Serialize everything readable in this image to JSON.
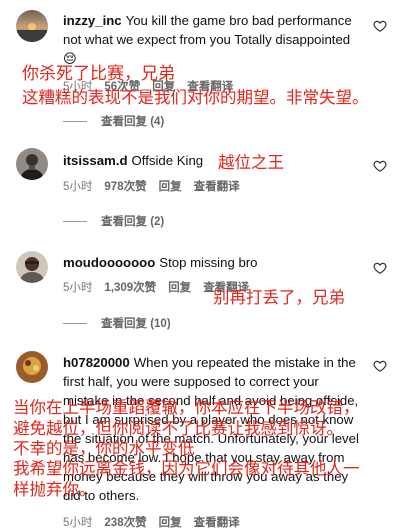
{
  "comments": [
    {
      "username": "inzzy_inc",
      "text": "You kill the game bro bad performance not what we expect from you Totally disappointed",
      "emoji": "😔",
      "time": "5小时",
      "likes": "56次赞",
      "reply_label": "回复",
      "translate_label": "查看翻译",
      "view_replies": "查看回复 (4)"
    },
    {
      "username": "itsissam.d",
      "text": "Offside King",
      "time": "5小时",
      "likes": "978次赞",
      "reply_label": "回复",
      "translate_label": "查看翻译",
      "view_replies": "查看回复 (2)"
    },
    {
      "username": "moudooooooo",
      "text": "Stop missing bro",
      "time": "5小时",
      "likes": "1,309次赞",
      "reply_label": "回复",
      "translate_label": "查看翻译",
      "view_replies": "查看回复 (10)"
    },
    {
      "username": "h07820000",
      "text": "When you repeated the mistake in the first half, you were supposed to correct your mistake in the second half and avoid being offside, but I am surprised by a player who does not know the situation of the match. Unfortunately, your level has become low. I hope that you stay away from money because they will throw you away as they did to others.",
      "time": "5小时",
      "likes": "238次赞",
      "reply_label": "回复",
      "translate_label": "查看翻译"
    }
  ],
  "translations": {
    "c1_line1": "你杀死了比赛，兄弟",
    "c1_line2": "这糟糕的表现不是我们对你的期望。非常失望。",
    "c2": "越位之王",
    "c3": "别再打丢了，兄弟",
    "c4_line1": "当你在上半场重蹈覆辙，你本应在下半场改错，",
    "c4_line2": "避免越位，但你阅读不了比赛让我感到惊讶。",
    "c4_line3": "不幸的是，你的水平变低",
    "c4_line4": "我希望你远离金钱，因为它们会像对待其他人一",
    "c4_line5": "样抛弃你。"
  },
  "colors": {
    "overlay_red": "#e3261b",
    "meta_gray": "#777777"
  },
  "icons": {
    "like": "heart-icon"
  }
}
